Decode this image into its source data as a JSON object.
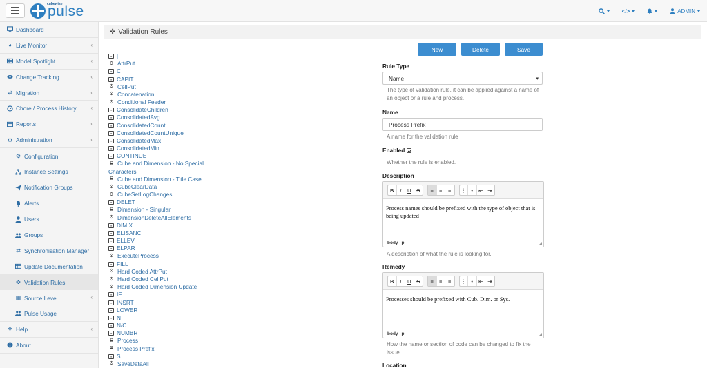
{
  "app": {
    "logo_small": "cubewise",
    "logo_text": "pulse"
  },
  "topbar": {
    "search_icon": "search-icon",
    "code_icon": "code-icon",
    "bell_icon": "bell-icon",
    "user_label": "ADMIN"
  },
  "sidebar": {
    "items": [
      {
        "label": "Dashboard",
        "icon": "monitor-icon",
        "chevron": false
      },
      {
        "label": "Live Monitor",
        "icon": "dashboard-icon",
        "chevron": true
      },
      {
        "label": "Model Spotlight",
        "icon": "table-icon",
        "chevron": true
      },
      {
        "label": "Change Tracking",
        "icon": "eye-icon",
        "chevron": true
      },
      {
        "label": "Migration",
        "icon": "exchange-icon",
        "chevron": true
      },
      {
        "label": "Chore / Process History",
        "icon": "clock-icon",
        "chevron": true
      },
      {
        "label": "Reports",
        "icon": "list-icon",
        "chevron": true
      },
      {
        "label": "Administration",
        "icon": "cogs-icon",
        "chevron": true
      }
    ],
    "subitems": [
      {
        "label": "Configuration",
        "icon": "cog-icon"
      },
      {
        "label": "Instance Settings",
        "icon": "sitemap-icon"
      },
      {
        "label": "Notification Groups",
        "icon": "paper-plane-icon"
      },
      {
        "label": "Alerts",
        "icon": "bell-icon"
      },
      {
        "label": "Users",
        "icon": "user-icon"
      },
      {
        "label": "Groups",
        "icon": "users-icon"
      },
      {
        "label": "Synchronisation Manager",
        "icon": "exchange-icon"
      },
      {
        "label": "Update Documentation",
        "icon": "table-icon"
      },
      {
        "label": "Validation Rules",
        "icon": "crosshair-icon",
        "active": true
      },
      {
        "label": "Source Level",
        "icon": "th-large-icon",
        "chevron": true
      },
      {
        "label": "Pulse Usage",
        "icon": "users-icon"
      }
    ],
    "bottom": [
      {
        "label": "Help",
        "icon": "life-ring-icon",
        "chevron": true
      },
      {
        "label": "About",
        "icon": "info-icon",
        "chevron": false
      }
    ]
  },
  "page": {
    "title": "Validation Rules"
  },
  "rules": [
    {
      "label": "[]",
      "icon": "calc"
    },
    {
      "label": "AttrPut",
      "icon": "cogs"
    },
    {
      "label": "C",
      "icon": "calc"
    },
    {
      "label": "CAPIT",
      "icon": "calc"
    },
    {
      "label": "CellPut",
      "icon": "cogs"
    },
    {
      "label": "Concatenation",
      "icon": "cogs"
    },
    {
      "label": "Conditional Feeder",
      "icon": "cogs"
    },
    {
      "label": "ConsolidateChildren",
      "icon": "calc"
    },
    {
      "label": "ConsolidatedAvg",
      "icon": "calc"
    },
    {
      "label": "ConsolidatedCount",
      "icon": "calc"
    },
    {
      "label": "ConsolidatedCountUnique",
      "icon": "calc"
    },
    {
      "label": "ConsolidatedMax",
      "icon": "calc"
    },
    {
      "label": "ConsolidatedMin",
      "icon": "calc"
    },
    {
      "label": "CONTINUE",
      "icon": "calc"
    },
    {
      "label": "Cube and Dimension - No Special",
      "cont": "Characters",
      "icon": "name"
    },
    {
      "label": "Cube and Dimension - Title Case",
      "icon": "name"
    },
    {
      "label": "CubeClearData",
      "icon": "cogs"
    },
    {
      "label": "CubeSetLogChanges",
      "icon": "cogs"
    },
    {
      "label": "DELET",
      "icon": "calc"
    },
    {
      "label": "Dimension - Singular",
      "icon": "name"
    },
    {
      "label": "DimensionDeleteAllElements",
      "icon": "cogs"
    },
    {
      "label": "DIMIX",
      "icon": "calc"
    },
    {
      "label": "ELISANC",
      "icon": "calc"
    },
    {
      "label": "ELLEV",
      "icon": "calc"
    },
    {
      "label": "ELPAR",
      "icon": "calc"
    },
    {
      "label": "ExecuteProcess",
      "icon": "cogs"
    },
    {
      "label": "FILL",
      "icon": "calc"
    },
    {
      "label": "Hard Coded AttrPut",
      "icon": "cogs"
    },
    {
      "label": "Hard Coded CellPut",
      "icon": "cogs"
    },
    {
      "label": "Hard Coded Dimension Update",
      "icon": "cogs"
    },
    {
      "label": "IF",
      "icon": "calc"
    },
    {
      "label": "INSRT",
      "icon": "calc"
    },
    {
      "label": "LOWER",
      "icon": "calc"
    },
    {
      "label": "N",
      "icon": "calc"
    },
    {
      "label": "N/C",
      "icon": "calc"
    },
    {
      "label": "NUMBR",
      "icon": "calc"
    },
    {
      "label": "Process",
      "icon": "name"
    },
    {
      "label": "Process Prefix",
      "icon": "name"
    },
    {
      "label": "S",
      "icon": "calc"
    },
    {
      "label": "SaveDataAll",
      "icon": "cogs"
    }
  ],
  "buttons": {
    "new": "New",
    "delete": "Delete",
    "save": "Save"
  },
  "form": {
    "rule_type_label": "Rule Type",
    "rule_type_value": "Name",
    "rule_type_help": "The type of validation rule, it can be applied against a name of an object or a rule and process.",
    "name_label": "Name",
    "name_value": "Process Prefix",
    "name_help": "A name for the validation rule",
    "enabled_label": "Enabled",
    "enabled_checked": true,
    "enabled_help": "Whether the rule is enabled.",
    "description_label": "Description",
    "description_value": "Process names should be prefixed with the type of object that is being updated",
    "description_help": "A description of what the rule is looking for.",
    "remedy_label": "Remedy",
    "remedy_value": "Processes should be prefixed with Cub. Dim. or Sys.",
    "remedy_help": "How the name or section of code can be changed to fix the issue.",
    "location_label": "Location",
    "editor_path_body": "body",
    "editor_path_p": "p"
  },
  "toolbar_buttons": [
    "B",
    "I",
    "U",
    "S"
  ]
}
